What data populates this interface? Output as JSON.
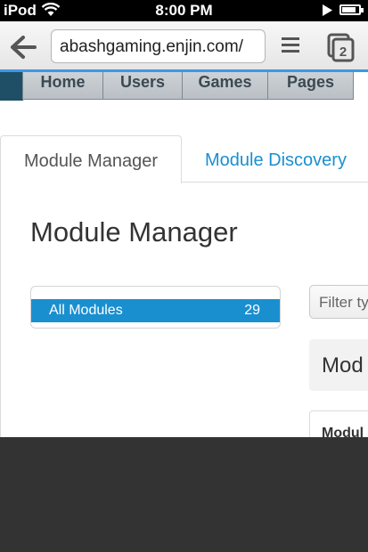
{
  "status_bar": {
    "carrier": "iPod",
    "time": "8:00 PM",
    "battery_level": 0.85
  },
  "browser": {
    "url": "abashgaming.enjin.com/",
    "tab_count": "2",
    "icons": [
      "back-arrow-icon",
      "menu-icon",
      "tabs-icon"
    ]
  },
  "site_nav": {
    "items": [
      "Home",
      "Users",
      "Games",
      "Pages"
    ]
  },
  "tabs": {
    "active": "Module Manager",
    "inactive": "Module Discovery"
  },
  "page": {
    "title": "Module Manager"
  },
  "modules": {
    "items": [
      {
        "label": "All Modules",
        "count": "29"
      }
    ]
  },
  "right_panel": {
    "filter_placeholder": "Filter ty",
    "heading": "Mod",
    "card_text": "Modul"
  },
  "colors": {
    "accent": "#1a8fd0",
    "toolbar_line": "#3c97e7",
    "overlay": "#333333"
  }
}
